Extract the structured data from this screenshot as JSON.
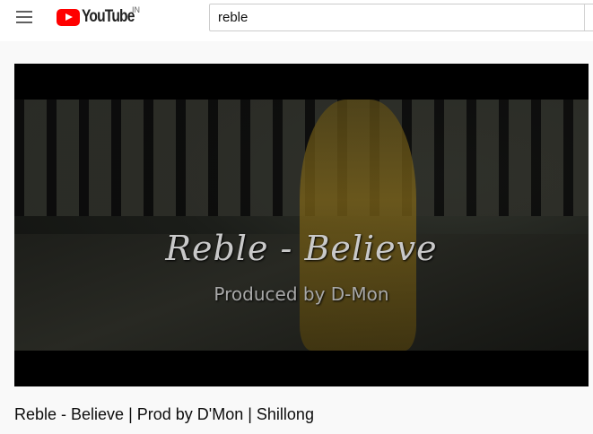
{
  "header": {
    "logo_text": "YouTube",
    "logo_region": "IN",
    "search": {
      "value": "reble"
    }
  },
  "video": {
    "overlay_title": "Reble - Believe",
    "overlay_subtitle": "Produced by D-Mon",
    "title": "Reble - Believe | Prod by D'Mon | Shillong"
  },
  "icons": {
    "menu": "hamburger-menu-icon",
    "logo": "youtube-play-icon"
  },
  "colors": {
    "brand_red": "#ff0000",
    "header_bg": "#ffffff",
    "page_bg": "#f9f9f9",
    "text_primary": "#0d0d0d"
  }
}
